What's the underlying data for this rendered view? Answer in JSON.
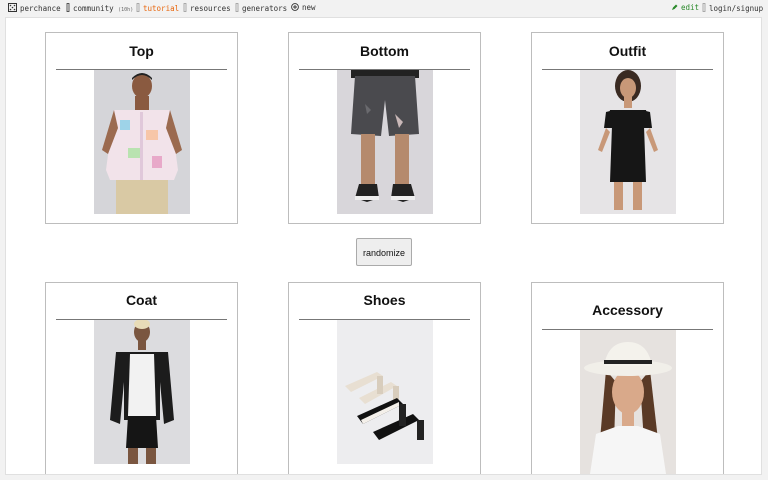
{
  "topbar": {
    "perchance": "perchance",
    "community": "community",
    "community_count": "(10h)",
    "tutorial": "tutorial",
    "resources": "resources",
    "generators": "generators",
    "new": "new",
    "edit": "edit",
    "login": "login/signup"
  },
  "cards": {
    "top": "Top",
    "bottom": "Bottom",
    "outfit": "Outfit",
    "coat": "Coat",
    "shoes": "Shoes",
    "accessory": "Accessory"
  },
  "randomize_label": "randomize",
  "colors": {
    "tutorial": "#e8650c",
    "edit": "#2a8a2a",
    "card_border": "#bdbdbd"
  }
}
